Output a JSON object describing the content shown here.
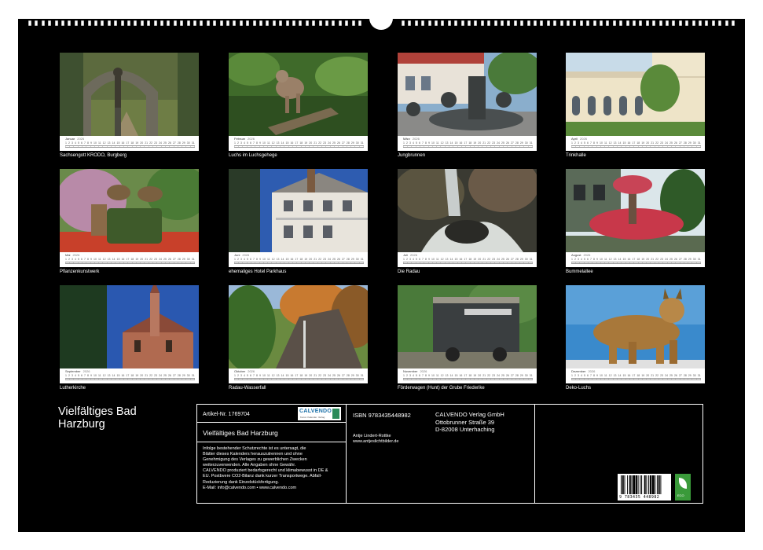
{
  "calendar_title": "Vielfältiges Bad Harzburg",
  "year": "2026",
  "weekday_letters": [
    "Do",
    "Fr",
    "Sa",
    "So",
    "Mo",
    "Di",
    "Mi",
    "Do",
    "Fr",
    "Sa",
    "So",
    "Mo",
    "Di",
    "Mi",
    "Do",
    "Fr",
    "Sa",
    "So",
    "Mo",
    "Di",
    "Mi",
    "Do",
    "Fr",
    "Sa",
    "So",
    "Mo",
    "Di",
    "Mi",
    "Do",
    "Fr",
    "Sa"
  ],
  "day_numbers": [
    "1",
    "2",
    "3",
    "4",
    "5",
    "6",
    "7",
    "8",
    "9",
    "10",
    "11",
    "12",
    "13",
    "14",
    "15",
    "16",
    "17",
    "18",
    "19",
    "20",
    "21",
    "22",
    "23",
    "24",
    "25",
    "26",
    "27",
    "28",
    "29",
    "30",
    "31"
  ],
  "months": [
    {
      "month": "Januar",
      "caption": "Sachsengott KRODO, Burgberg"
    },
    {
      "month": "Februar",
      "caption": "Luchs im Luchsgehege"
    },
    {
      "month": "März",
      "caption": "Jungbrunnen"
    },
    {
      "month": "April",
      "caption": "Trinkhalle"
    },
    {
      "month": "Mai",
      "caption": "Pflanzenkunstwerk"
    },
    {
      "month": "Juni",
      "caption": "ehemaliges Hotel Parkhaus"
    },
    {
      "month": "Juli",
      "caption": "Die Radau"
    },
    {
      "month": "August",
      "caption": "Bummelallee"
    },
    {
      "month": "September",
      "caption": "Lutherkirche"
    },
    {
      "month": "Oktober",
      "caption": "Radau-Wasserfall"
    },
    {
      "month": "November",
      "caption": "Förderwagen (Hunt) der Grube Friederike"
    },
    {
      "month": "Dezember",
      "caption": "Deko-Luchs"
    }
  ],
  "info": {
    "article_no": "Artikel-Nr. 1769704",
    "product_title": "Vielfältiges Bad Harzburg",
    "legal_lines": [
      "Infolge bestehender Schutzrechte ist es untersagt, die",
      "Blätter dieses Kalenders herauszutrennen und ohne",
      "Genehmigung des Verlages zu gewerblichen Zwecken",
      "weiterzuverwenden. Alle Angaben ohne Gewähr.",
      "CALVENDO produziert bedarfsgerecht und klimabewusst in DE &",
      "EU. Postbvere CO2-Bilanz dank kurzer Transportwege. Abfall-",
      "Reduzierung dank Einzelstückfertigung.",
      "E-Mail: info@calvendo.com • www.calvendo.com"
    ],
    "isbn": "ISBN 9783435448982",
    "author": "Antje Lindert-Rottke",
    "author_web": "www.antjeslichtbilder.de",
    "publisher_lines": [
      "CALVENDO Verlag GmbH",
      "Ottobrunner Straße 39",
      "D-82008 Unterhaching"
    ],
    "barcode_digits": "9 783435 448982",
    "logo_word": "CALVENDO",
    "logo_sub": "Kunst. Kalender. Verlag",
    "eco_label": "ECO"
  },
  "colors": {
    "background": "#000000",
    "page": "#ffffff",
    "text": "#ffffff",
    "calvendo_blue": "#1a6fa8"
  }
}
